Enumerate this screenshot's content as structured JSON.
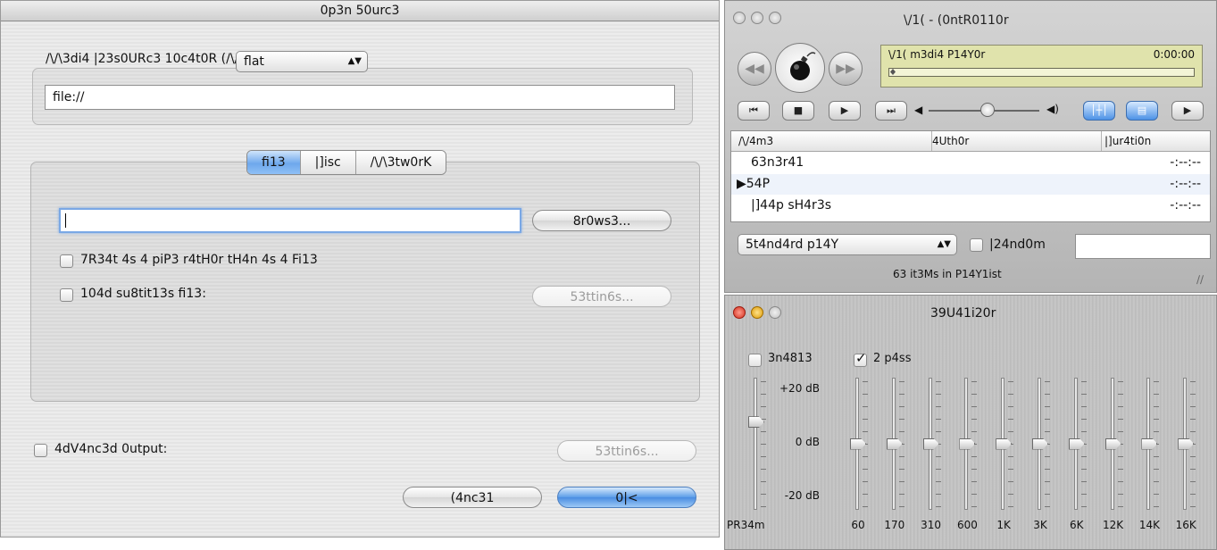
{
  "dialog": {
    "title": "0p3n 50urc3",
    "mrl_label": "/\\/\\3di4 |23s0URc3 10c4t0R (/\\/\\|21)",
    "mrl_value": "file://",
    "tabs": [
      {
        "label": "fi13",
        "active": true
      },
      {
        "label": "|]isc",
        "active": false
      },
      {
        "label": "/\\/\\3tw0rK",
        "active": false
      }
    ],
    "file_value": "",
    "browse_label": "8r0ws3...",
    "pipe_checkbox_label": "7R34t 4s 4 piP3 r4tH0r tH4n 4s 4 Fi13",
    "pipe_checked": false,
    "subtitle_checkbox_label": "104d su8tit13s fi13:",
    "subtitle_checked": false,
    "subtitle_settings_label": "53ttin6s...",
    "advanced_checkbox_label": "4dV4nc3d 0utput:",
    "advanced_checked": false,
    "advanced_settings_label": "53ttin6s...",
    "cancel_label": "(4nc31",
    "ok_label": "0|<"
  },
  "controller": {
    "title": "\\/1( - (0ntR0110r",
    "lcd_title": "\\/1( m3di4 P14Y0r",
    "lcd_time": "0:00:00",
    "playlist_columns": [
      "/\\/4m3",
      "4Uth0r",
      "|]ur4ti0n"
    ],
    "playlist_rows": [
      {
        "name": "63n3r41",
        "author": "",
        "duration": "-:--:--"
      },
      {
        "name": "▶54P",
        "author": "",
        "duration": "-:--:--"
      },
      {
        "name": "|]44p sH4r3s",
        "author": "",
        "duration": "-:--:--"
      }
    ],
    "mode_select": "5t4nd4rd p14Y",
    "random_label": "|24nd0m",
    "random_checked": false,
    "playlist_count": "63 it3Ms in P14Y1ist"
  },
  "equalizer": {
    "title": "39U41i20r",
    "enable_label": "3n4813",
    "enable_checked": false,
    "two_pass_label": "2 p4ss",
    "two_pass_checked": true,
    "preset": "flat",
    "db_labels": [
      "+20 dB",
      "0 dB",
      "-20 dB"
    ],
    "preamp_label": "PR34m",
    "preamp_level": 0.68,
    "bands": [
      "60",
      "170",
      "310",
      "600",
      "1K",
      "3K",
      "6K",
      "12K",
      "14K",
      "16K"
    ],
    "band_levels_db": [
      0,
      0,
      0,
      0,
      0,
      0,
      0,
      0,
      0,
      0
    ]
  },
  "colors": {
    "accent_blue": "#5b9ce8",
    "lcd_background": "#e0e3ac"
  }
}
